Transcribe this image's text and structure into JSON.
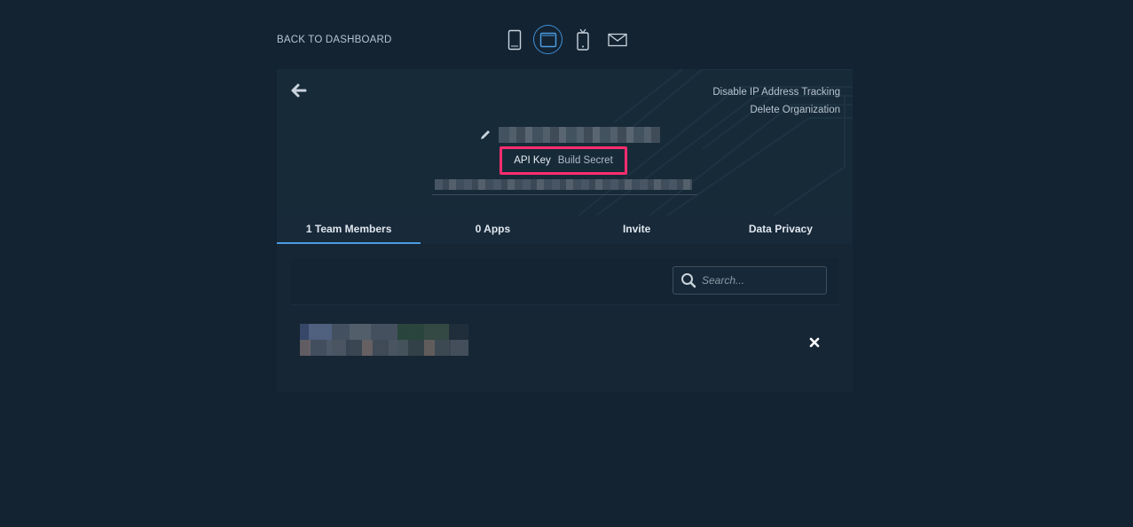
{
  "nav": {
    "back_label": "BACK TO DASHBOARD"
  },
  "device_icons": [
    "phone-icon",
    "tablet-icon",
    "mobile-device-icon",
    "mail-icon"
  ],
  "header": {
    "disable_ip_label": "Disable IP Address Tracking",
    "delete_org_label": "Delete Organization"
  },
  "key_tabs": {
    "api_key_label": "API Key",
    "build_secret_label": "Build Secret"
  },
  "tabs": [
    {
      "label": "1 Team Members",
      "active": true
    },
    {
      "label": "0 Apps",
      "active": false
    },
    {
      "label": "Invite",
      "active": false
    },
    {
      "label": "Data Privacy",
      "active": false
    }
  ],
  "search": {
    "placeholder": "Search..."
  },
  "colors": {
    "background": "#132332",
    "accent": "#4a9be0",
    "highlight": "#ff2d6f"
  }
}
